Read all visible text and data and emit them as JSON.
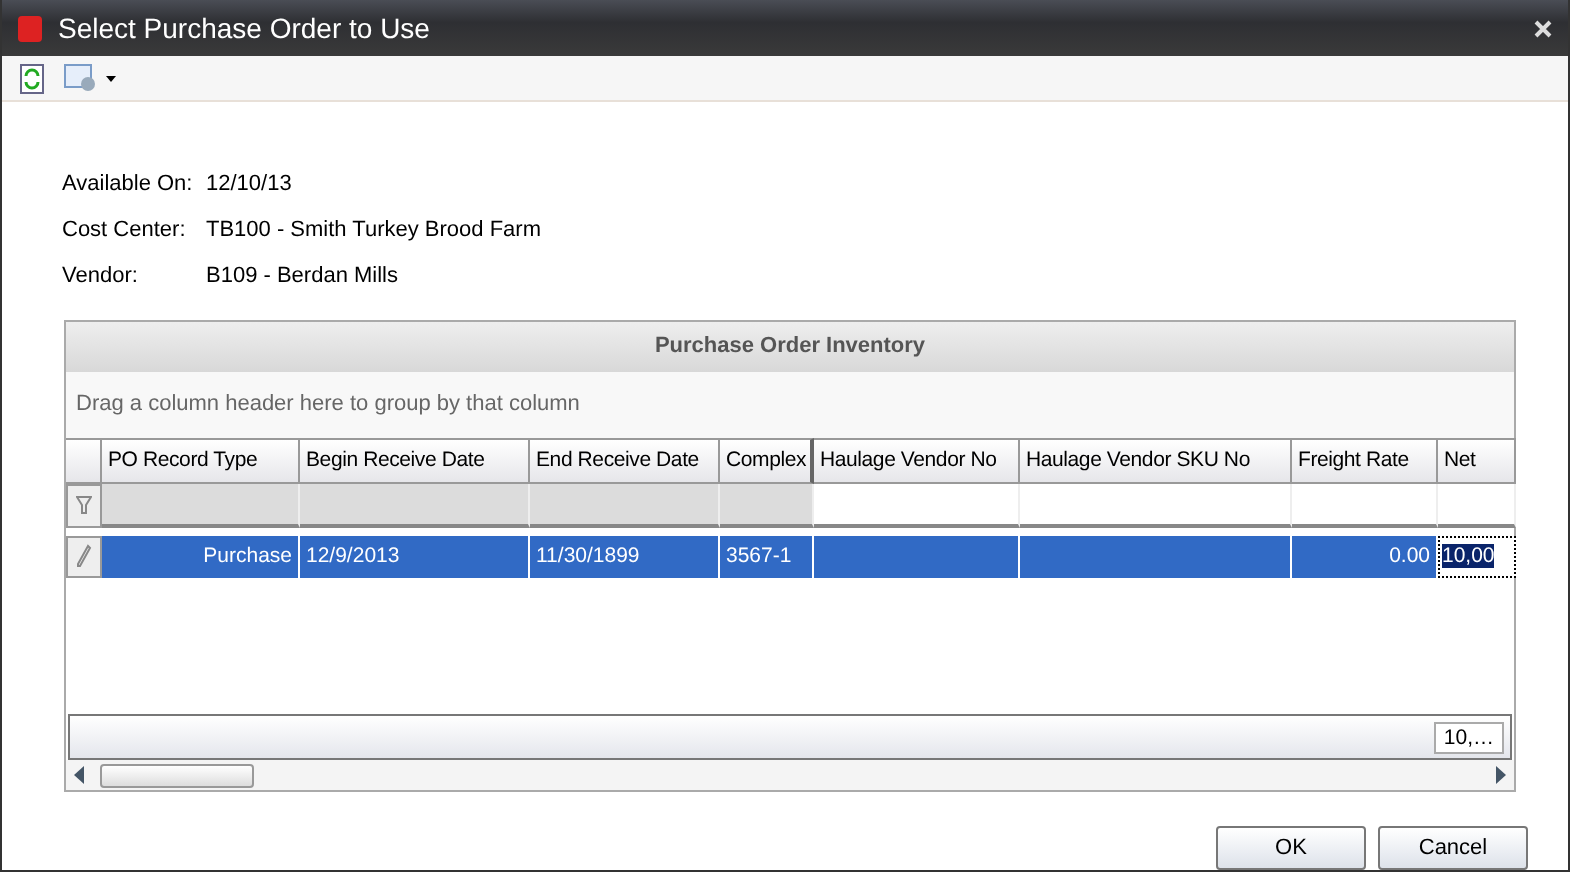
{
  "window": {
    "title": "Select Purchase Order to Use"
  },
  "info": [
    {
      "label": "Available On:",
      "value": "12/10/13"
    },
    {
      "label": "Cost Center:",
      "value": "TB100 - Smith Turkey Brood Farm"
    },
    {
      "label": "Vendor:",
      "value": "B109 - Berdan Mills"
    }
  ],
  "grid": {
    "title": "Purchase Order Inventory",
    "group_hint": "Drag a column header here to group by that column",
    "columns": [
      {
        "label": "PO Record Type",
        "frozen": true
      },
      {
        "label": "Begin Receive Date",
        "frozen": true
      },
      {
        "label": "End Receive Date",
        "frozen": true
      },
      {
        "label": "Complex",
        "frozen": true
      },
      {
        "label": "Haulage Vendor No",
        "frozen": false
      },
      {
        "label": "Haulage Vendor SKU No",
        "frozen": false
      },
      {
        "label": "Freight Rate",
        "frozen": false
      },
      {
        "label": "Net",
        "frozen": false
      }
    ],
    "rows": [
      {
        "selected": true,
        "cells": [
          "Purchase",
          "12/9/2013",
          "11/30/1899",
          "3567-1",
          "",
          "",
          "0.00",
          "10,00"
        ]
      }
    ],
    "summary": "10,…"
  },
  "buttons": [
    "OK",
    "Cancel"
  ]
}
